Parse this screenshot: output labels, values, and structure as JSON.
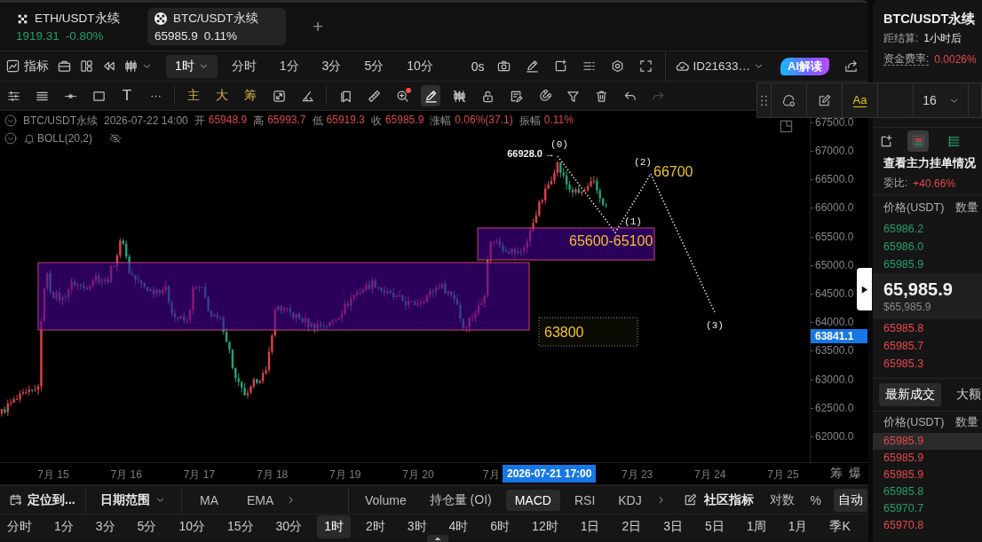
{
  "tabs": [
    {
      "symbol": "ETH/USDT永续",
      "price": "1919.31",
      "change": "-0.80%",
      "color": "#22a06b",
      "selected": false
    },
    {
      "symbol": "BTC/USDT永续",
      "price": "65985.9",
      "change": "0.11%",
      "color": "#e6e6e6",
      "selected": true
    }
  ],
  "add_tab": "+",
  "toolbar": {
    "indicators": "指标",
    "intervals": [
      {
        "label": "1时",
        "kind": "dropdown",
        "selected": true
      },
      {
        "label": "分时",
        "kind": "plain",
        "selected": false
      },
      {
        "label": "1分",
        "kind": "plain",
        "selected": false
      },
      {
        "label": "3分",
        "kind": "plain",
        "selected": false
      },
      {
        "label": "5分",
        "kind": "plain",
        "selected": false
      },
      {
        "label": "10分",
        "kind": "plain",
        "selected": false
      }
    ],
    "countdown": "0s",
    "account": "ID21633…",
    "ai_button": "AI解读"
  },
  "drawing_toolbar": {
    "text_tool": "T",
    "chips": [
      "主",
      "大",
      "筹"
    ],
    "tools": [
      {
        "selected": false,
        "disabled": false,
        "alert": false
      },
      {
        "selected": false,
        "disabled": false,
        "alert": false
      },
      {
        "selected": false,
        "disabled": false,
        "alert": true
      },
      {
        "selected": true,
        "disabled": false,
        "alert": false
      },
      {
        "selected": false,
        "disabled": false,
        "alert": false
      },
      {
        "selected": false,
        "disabled": false,
        "alert": false
      },
      {
        "selected": false,
        "disabled": false,
        "alert": false
      },
      {
        "selected": false,
        "disabled": false,
        "alert": false
      },
      {
        "selected": false,
        "disabled": false,
        "alert": false
      },
      {
        "selected": false,
        "disabled": false,
        "alert": false
      },
      {
        "selected": false,
        "disabled": false,
        "alert": false
      },
      {
        "selected": false,
        "disabled": true,
        "alert": false
      }
    ]
  },
  "style_panel": {
    "font_sample": "Aa",
    "font_size": "16"
  },
  "chart": {
    "symbol": "BTC/USDT永续",
    "time": "2026-07-22 14:00",
    "quote": [
      {
        "label": "开",
        "value": "65948.9"
      },
      {
        "label": "高",
        "value": "65993.7"
      },
      {
        "label": "低",
        "value": "65919.3"
      },
      {
        "label": "收",
        "value": "65985.9"
      },
      {
        "label": "涨幅",
        "value": "0.06%(37.1)"
      },
      {
        "label": "振幅",
        "value": "0.11%"
      }
    ],
    "indicator": "BOLL(20,2)",
    "indicator_visible": false,
    "price_ticks": [
      "67500.0",
      "67000.0",
      "66500.0",
      "66000.0",
      "65500.0",
      "65000.0",
      "64500.0",
      "64000.0",
      "63500.0",
      "63000.0",
      "62500.0",
      "62000.0"
    ],
    "date_ticks": [
      "7月 15",
      "7月 16",
      "7月 17",
      "7月 18",
      "7月 19",
      "7月 20",
      "7月",
      "7月 23",
      "7月 24",
      "7月 25"
    ],
    "crosshair": {
      "price": "63841.1",
      "time": "2026-07-21 17:00"
    },
    "axis_tools": [
      "筹",
      "爆"
    ],
    "drawings": {
      "peak_label": "66928.0 →",
      "wave_labels": [
        "(0)",
        "(1)",
        "(2)",
        "(3)"
      ],
      "zone_label": "65600-65100",
      "target_labels": [
        "63800",
        "66700"
      ]
    }
  },
  "bottom_bar": {
    "locate": "定位到...",
    "date_range": "日期范围",
    "main_indicators": [
      "MA",
      "EMA"
    ],
    "sub_indicators": [
      {
        "label": "Volume",
        "selected": false
      },
      {
        "label": "持仓量 (OI)",
        "selected": false
      },
      {
        "label": "MACD",
        "selected": true
      },
      {
        "label": "RSI",
        "selected": false
      },
      {
        "label": "KDJ",
        "selected": false
      }
    ],
    "community": "社区指标",
    "scales": [
      {
        "label": "对数",
        "selected": false
      },
      {
        "label": "%",
        "selected": false
      },
      {
        "label": "自动",
        "selected": true
      }
    ]
  },
  "periods": [
    {
      "label": "分时",
      "selected": false
    },
    {
      "label": "1分",
      "selected": false
    },
    {
      "label": "3分",
      "selected": false
    },
    {
      "label": "5分",
      "selected": false
    },
    {
      "label": "10分",
      "selected": false
    },
    {
      "label": "15分",
      "selected": false
    },
    {
      "label": "30分",
      "selected": false
    },
    {
      "label": "1时",
      "selected": true
    },
    {
      "label": "2时",
      "selected": false
    },
    {
      "label": "3时",
      "selected": false
    },
    {
      "label": "4时",
      "selected": false
    },
    {
      "label": "6时",
      "selected": false
    },
    {
      "label": "12时",
      "selected": false
    },
    {
      "label": "1日",
      "selected": false
    },
    {
      "label": "2日",
      "selected": false
    },
    {
      "label": "3日",
      "selected": false
    },
    {
      "label": "5日",
      "selected": false
    },
    {
      "label": "1周",
      "selected": false
    },
    {
      "label": "1月",
      "selected": false
    },
    {
      "label": "季K",
      "selected": false
    }
  ],
  "side_panel": {
    "title": "BTC/USDT永续",
    "stats": [
      {
        "label": "距结算:",
        "value": "1小时后",
        "color": "#e6e6e6",
        "tooltip": false
      },
      {
        "label": "资金费率:",
        "value": "0.0026%",
        "color": "#e5484d",
        "tooltip": true
      }
    ],
    "book_views": [
      {
        "selected": true
      },
      {
        "selected": false
      }
    ],
    "book_heading": "查看主力挂单情况",
    "ratio_label": "委比:",
    "ratio": "+40.66%",
    "book_columns": [
      "价格(USDT)",
      "数量"
    ],
    "asks": [
      {
        "price": "65986.2",
        "color": "#22a06b"
      },
      {
        "price": "65986.0",
        "color": "#22a06b"
      },
      {
        "price": "65985.9",
        "color": "#22a06b"
      }
    ],
    "last_price": "65,985.9",
    "last_price_usd": "$65,985.9",
    "bids": [
      {
        "price": "65985.8",
        "color": "#e5484d"
      },
      {
        "price": "65985.7",
        "color": "#e5484d"
      },
      {
        "price": "65985.3",
        "color": "#e5484d"
      }
    ],
    "trade_tabs": [
      {
        "label": "最新成交",
        "selected": true
      },
      {
        "label": "大额",
        "selected": false
      }
    ],
    "trade_columns": [
      "价格(USDT)",
      "数量"
    ],
    "trades": [
      {
        "price": "65985.9",
        "color": "#e5484d",
        "highlighted": true
      },
      {
        "price": "65985.9",
        "color": "#e5484d",
        "highlighted": false
      },
      {
        "price": "65985.9",
        "color": "#e5484d",
        "highlighted": false
      },
      {
        "price": "65985.8",
        "color": "#22a06b",
        "highlighted": false
      },
      {
        "price": "65970.7",
        "color": "#22a06b",
        "highlighted": false
      },
      {
        "price": "65970.8",
        "color": "#e5484d",
        "highlighted": false
      }
    ]
  }
}
